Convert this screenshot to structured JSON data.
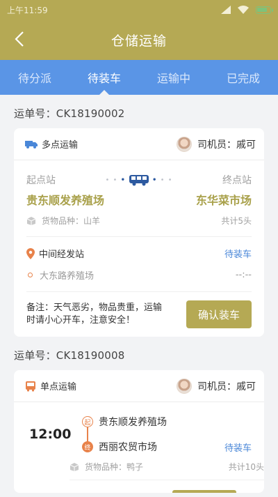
{
  "status_bar": {
    "time": "上午11:59"
  },
  "header": {
    "title": "仓储运输"
  },
  "tabs": [
    {
      "label": "待分派",
      "active": false
    },
    {
      "label": "待装车",
      "active": true
    },
    {
      "label": "运输中",
      "active": false
    },
    {
      "label": "已完成",
      "active": false
    }
  ],
  "orders": [
    {
      "order_no": "运单号：CK18190002",
      "type_label": "多点运输",
      "driver": "司机员：戚可",
      "start_label": "起点站",
      "end_label": "终点站",
      "start_place": "贵东顺发养殖场",
      "end_place": "东华菜市场",
      "cargo": "货物品种：山羊",
      "total": "共计5头",
      "mid_label": "中间经发站",
      "mid_status": "待装车",
      "mid_sub": "大东路养殖场",
      "mid_sub_value": "--:--",
      "note": "备注：天气恶劣，物品贵重，运输时请小心开车，注意安全！",
      "confirm_label": "确认装车"
    },
    {
      "order_no": "运单号：CK18190008",
      "type_label": "单点运输",
      "driver": "司机员：戚可",
      "time": "12:00",
      "start_badge": "起",
      "end_badge": "终",
      "start_place": "贵东顺发养殖场",
      "end_place": "西丽农贸市场",
      "status": "待装车",
      "cargo": "货物品种：鸭子",
      "total": "共计10头"
    }
  ],
  "colors": {
    "brand": "#b5a954",
    "tabbar": "#5a95e6",
    "accent_orange": "#e8824a",
    "link_blue": "#4a87d8"
  }
}
